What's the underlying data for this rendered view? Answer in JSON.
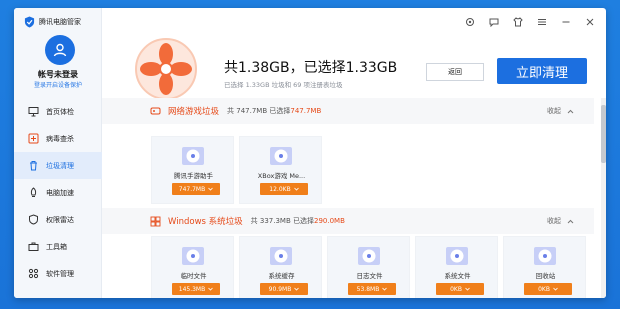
{
  "app": {
    "title": "腾讯电脑管家",
    "accent": "#1c6fe0",
    "warn": "#e64a19"
  },
  "user": {
    "login_title": "帐号未登录",
    "login_sub": "登录开启设备保护"
  },
  "sidebar": {
    "items": [
      {
        "label": "首页体检",
        "icon": "monitor-icon"
      },
      {
        "label": "病毒查杀",
        "icon": "virus-scan-icon"
      },
      {
        "label": "垃圾清理",
        "icon": "trash-icon",
        "active": true
      },
      {
        "label": "电脑加速",
        "icon": "rocket-icon"
      },
      {
        "label": "权限雷达",
        "icon": "radar-icon"
      },
      {
        "label": "工具箱",
        "icon": "toolbox-icon"
      },
      {
        "label": "软件管理",
        "icon": "apps-icon"
      }
    ]
  },
  "titlebar": {
    "icons": [
      "settings-icon",
      "message-icon",
      "skin-icon",
      "menu-icon",
      "minimize-icon",
      "close-icon"
    ]
  },
  "header": {
    "total": "共1.38GB，已选择1.33GB",
    "summary": "已选择 1.33GB 垃圾和 69 项注册表垃圾",
    "back_label": "返回",
    "clean_label": "立即清理"
  },
  "sections": [
    {
      "title": "网络游戏垃圾",
      "total": "共 747.7MB",
      "selected_prefix": "已选择",
      "selected": "747.7MB",
      "collapse_label": "收起",
      "cards": [
        {
          "label": "腾讯手游助手",
          "size": "747.7MB"
        },
        {
          "label": "XBox游戏 Me...",
          "size": "12.0KB"
        }
      ]
    },
    {
      "title": "Windows 系统垃圾",
      "total": "共 337.3MB",
      "selected_prefix": "已选择",
      "selected": "290.0MB",
      "collapse_label": "收起",
      "cards": [
        {
          "label": "临时文件",
          "size": "145.3MB"
        },
        {
          "label": "系统缓存",
          "size": "90.9MB"
        },
        {
          "label": "日志文件",
          "size": "53.8MB"
        },
        {
          "label": "系统文件",
          "size": "0KB"
        },
        {
          "label": "回收站",
          "size": "0KB"
        }
      ]
    }
  ]
}
